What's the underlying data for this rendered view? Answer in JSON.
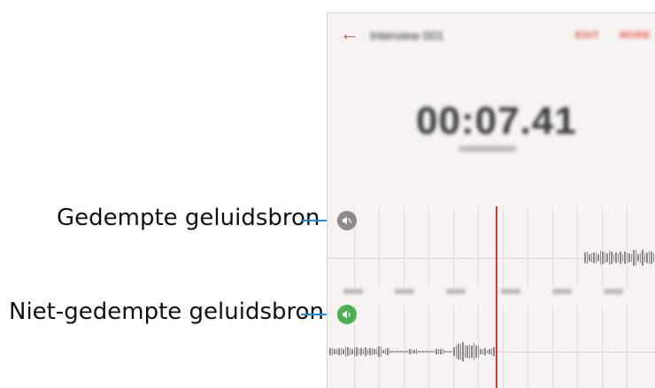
{
  "callouts": {
    "muted": "Gedempte geluidsbron",
    "unmuted": "Niet-gedempte geluidsbron"
  },
  "toolbar": {
    "title": "Interview 001",
    "edit_label": "EDIT",
    "more_label": "MORE"
  },
  "player": {
    "elapsed": "00:07.41"
  },
  "colors": {
    "accent": "#e0593f",
    "playhead": "#d23c28",
    "callout_line": "#1a8ed6",
    "muted_icon_bg": "#8f8a8a",
    "unmuted_icon_bg": "#4caf50"
  },
  "icons": {
    "back": "arrow-left-icon",
    "muted_source": "speaker-muted-icon",
    "unmuted_source": "speaker-on-icon"
  }
}
